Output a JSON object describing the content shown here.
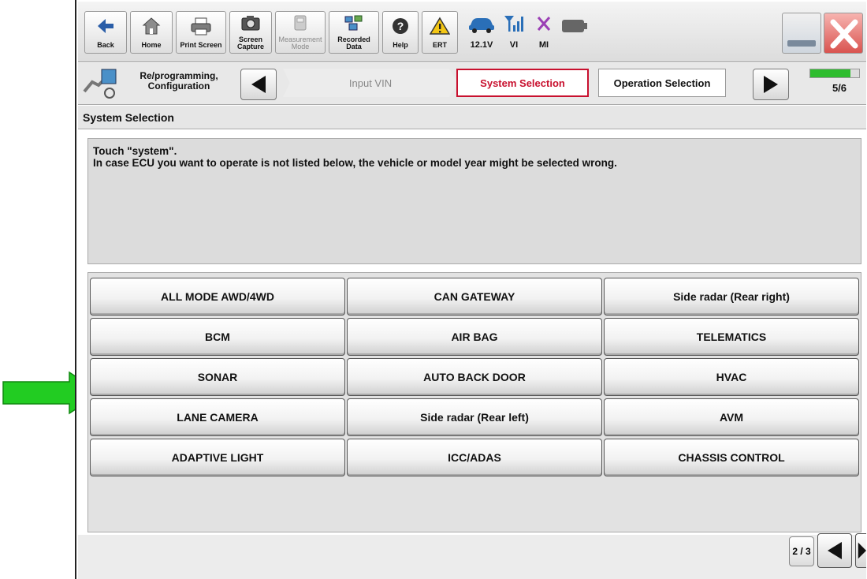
{
  "toolbar": {
    "back": "Back",
    "home": "Home",
    "print_screen": "Print Screen",
    "screen_capture": "Screen\nCapture",
    "measurement_mode": "Measurement\nMode",
    "recorded_data": "Recorded\nData",
    "help": "Help",
    "ert": "ERT",
    "voltage": "12.1V",
    "vi": "VI",
    "mi": "MI"
  },
  "nav": {
    "section": "Re/programming,\nConfiguration",
    "step_input_vin": "Input VIN",
    "step_system_selection": "System Selection",
    "step_operation_selection": "Operation Selection",
    "progress": "5/6",
    "progress_fraction": 0.83
  },
  "page": {
    "title": "System Selection",
    "message_line1": "Touch \"system\".",
    "message_line2": "In case ECU you want to operate is not listed below, the vehicle or model year might be selected wrong."
  },
  "systems": [
    [
      "ALL MODE AWD/4WD",
      "CAN GATEWAY",
      "Side radar (Rear right)"
    ],
    [
      "BCM",
      "AIR BAG",
      "TELEMATICS"
    ],
    [
      "SONAR",
      "AUTO BACK DOOR",
      "HVAC"
    ],
    [
      "LANE CAMERA",
      "Side radar (Rear left)",
      "AVM"
    ],
    [
      "ADAPTIVE LIGHT",
      "ICC/ADAS",
      "CHASSIS CONTROL"
    ]
  ],
  "pager": {
    "label": "2 / 3"
  },
  "colors": {
    "active_step": "#c8102e",
    "pointer_arrow": "#22cc22",
    "progress_bar": "#2ebd2e",
    "close_button": "#d9534f"
  }
}
